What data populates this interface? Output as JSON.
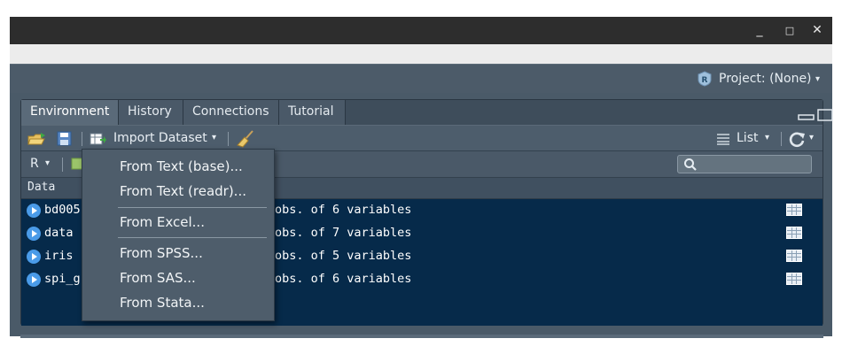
{
  "window": {
    "minimize_glyph": "_",
    "maximize_glyph": "□",
    "close_glyph": "✕"
  },
  "project": {
    "label": "Project: (None)",
    "caret": "▾"
  },
  "pane": {
    "tabs": [
      {
        "label": "Environment",
        "active": true
      },
      {
        "label": "History",
        "active": false
      },
      {
        "label": "Connections",
        "active": false
      },
      {
        "label": "Tutorial",
        "active": false
      }
    ]
  },
  "toolbar": {
    "import_label": "Import Dataset",
    "import_caret": "▾",
    "view_label": "List",
    "view_caret": "▾",
    "refresh_caret": "▾"
  },
  "toolbar2": {
    "language": "R",
    "language_caret": "▾"
  },
  "section_header": "Data",
  "rows": [
    {
      "name": "bd005",
      "desc": "obs. of 6 variables"
    },
    {
      "name": "data",
      "desc": "obs. of 7 variables"
    },
    {
      "name": "iris",
      "desc": "obs. of 5 variables"
    },
    {
      "name": "spi_g",
      "desc": "obs. of 6 variables"
    }
  ],
  "import_menu": {
    "items": [
      "From Text (base)...",
      "From Text (readr)...",
      "From Excel...",
      "From SPSS...",
      "From SAS...",
      "From Stata..."
    ]
  },
  "colors": {
    "data_bg": "#062a4a",
    "pane_bg": "#4a5968",
    "accent": "#4a9be8"
  }
}
